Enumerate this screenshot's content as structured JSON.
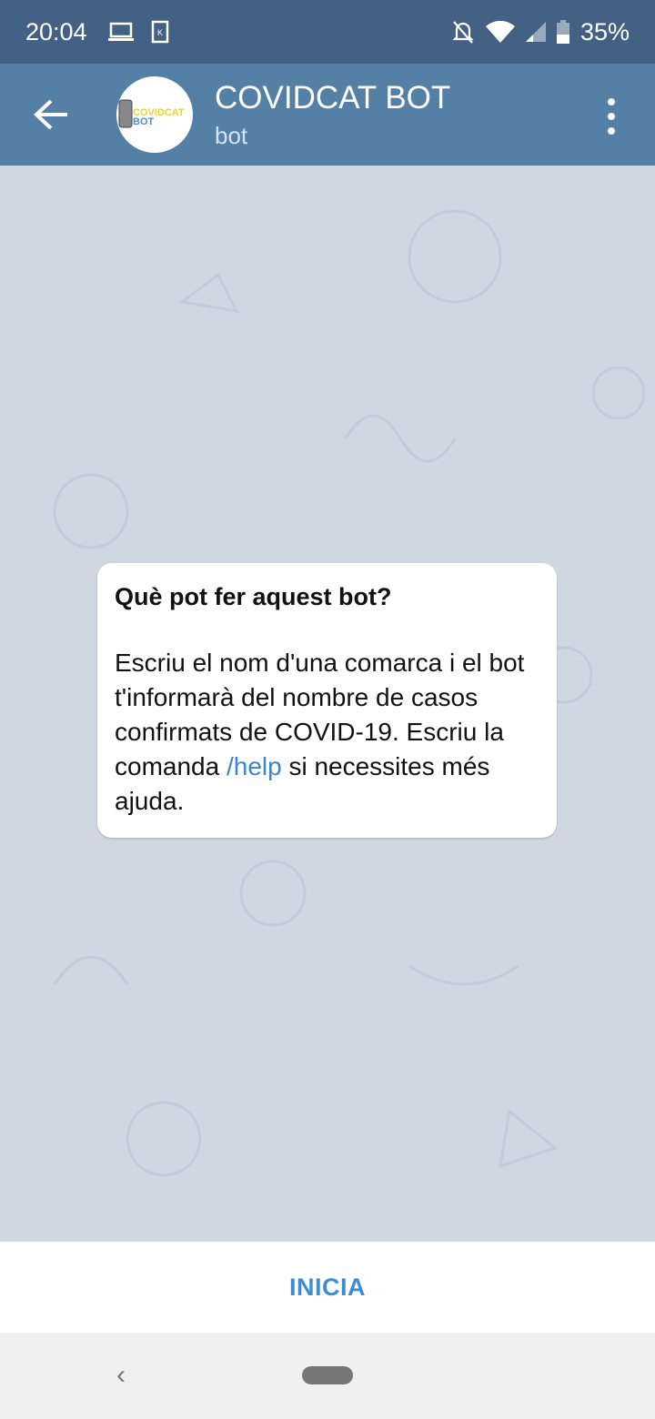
{
  "status_bar": {
    "time": "20:04",
    "battery": "35%"
  },
  "header": {
    "title": "COVIDCAT BOT",
    "subtitle": "bot",
    "avatar_logo_text": "COVIDCAT BOT"
  },
  "message": {
    "heading": "Què pot fer aquest bot?",
    "text_before": "Escriu el nom d'una comarca i el bot t'informarà del nombre de casos confirmats de COVID-19. Escriu la comanda ",
    "command": "/help",
    "text_after": " si necessites més ajuda."
  },
  "bottom": {
    "start_label": "INICIA"
  },
  "colors": {
    "status_bar": "#426184",
    "header": "#5480a6",
    "link": "#3d85c6",
    "background": "#cfd8e2"
  }
}
